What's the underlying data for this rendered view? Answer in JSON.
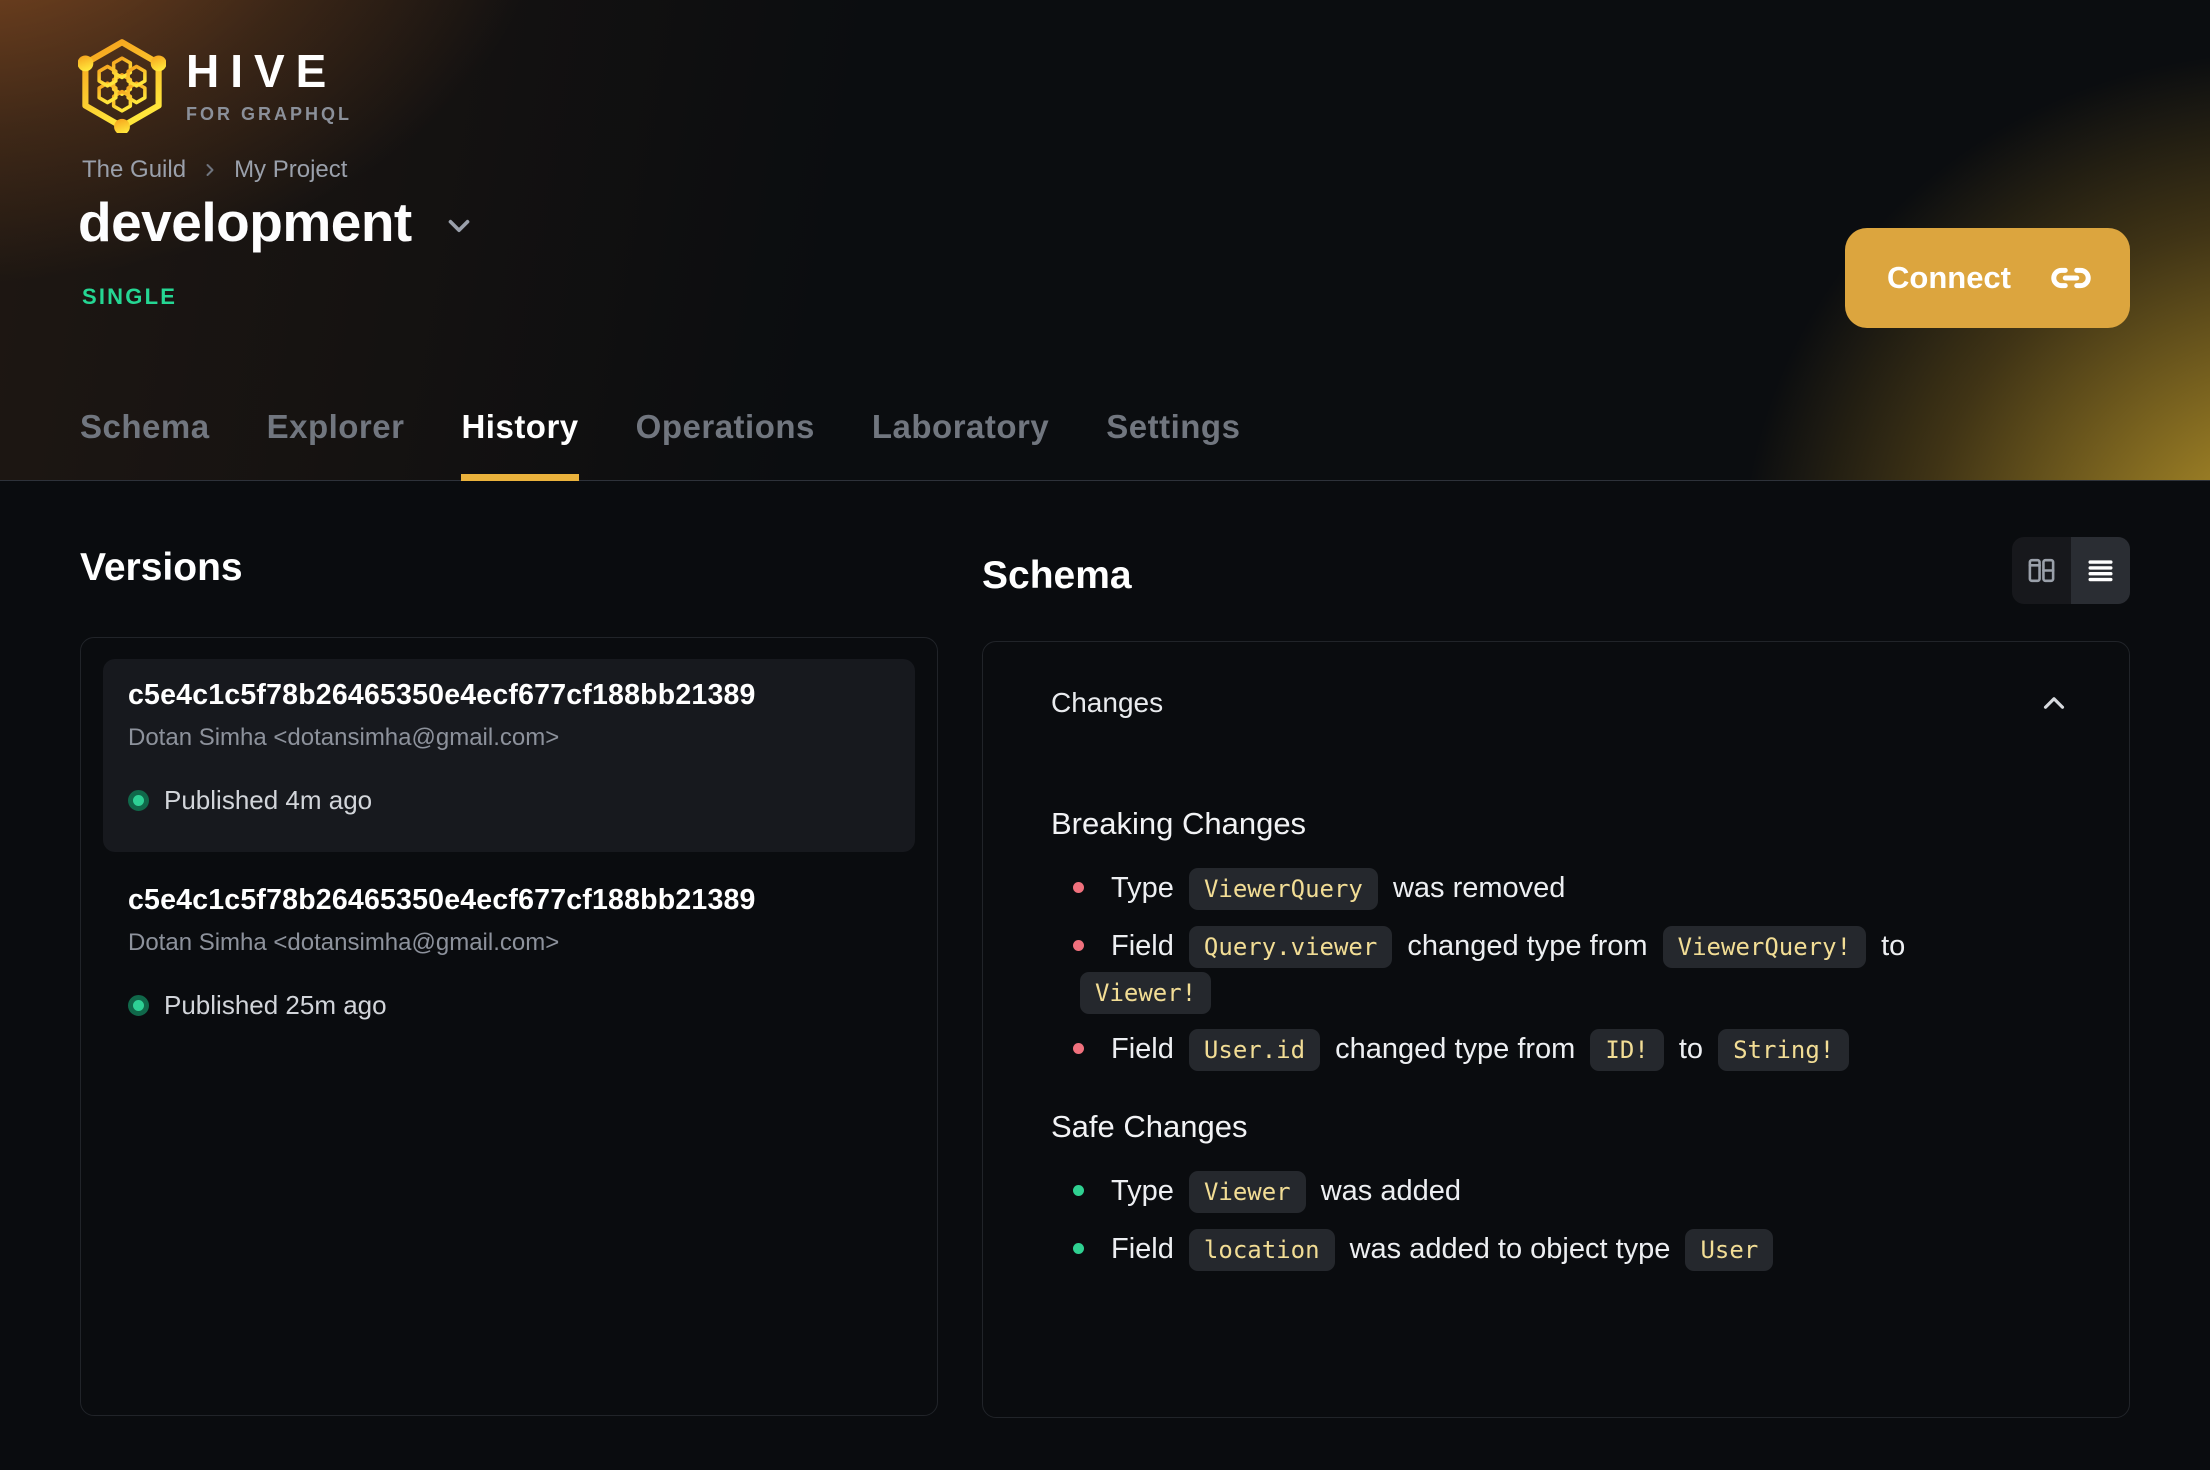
{
  "brand": {
    "name": "HIVE",
    "tagline": "FOR GRAPHQL"
  },
  "breadcrumb": {
    "items": [
      "The Guild",
      "My Project"
    ]
  },
  "target": {
    "name": "development",
    "badge": "SINGLE"
  },
  "connect": {
    "label": "Connect"
  },
  "nav": {
    "tabs": [
      {
        "label": "Schema",
        "active": false
      },
      {
        "label": "Explorer",
        "active": false
      },
      {
        "label": "History",
        "active": true
      },
      {
        "label": "Operations",
        "active": false
      },
      {
        "label": "Laboratory",
        "active": false
      },
      {
        "label": "Settings",
        "active": false
      }
    ]
  },
  "versions": {
    "heading": "Versions",
    "items": [
      {
        "hash": "c5e4c1c5f78b26465350e4ecf677cf188bb21389",
        "author": "Dotan Simha <dotansimha@gmail.com>",
        "status": "Published 4m ago",
        "highlighted": true
      },
      {
        "hash": "c5e4c1c5f78b26465350e4ecf677cf188bb21389",
        "author": "Dotan Simha <dotansimha@gmail.com>",
        "status": "Published 25m ago",
        "highlighted": false
      }
    ]
  },
  "schema": {
    "heading": "Schema",
    "view_toggle": {
      "options": [
        "columns-view",
        "list-view"
      ],
      "active": "list-view"
    },
    "changes": {
      "label": "Changes",
      "collapsed": false,
      "sections": [
        {
          "title": "Breaking Changes",
          "kind": "breaking",
          "items": [
            [
              {
                "text": "Type "
              },
              {
                "code": "ViewerQuery"
              },
              {
                "text": " was removed"
              }
            ],
            [
              {
                "text": "Field "
              },
              {
                "code": "Query.viewer"
              },
              {
                "text": " changed type from "
              },
              {
                "code": "ViewerQuery!"
              },
              {
                "text": " to "
              },
              {
                "code": "Viewer!"
              }
            ],
            [
              {
                "text": "Field "
              },
              {
                "code": "User.id"
              },
              {
                "text": " changed type from "
              },
              {
                "code": "ID!"
              },
              {
                "text": " to "
              },
              {
                "code": "String!"
              }
            ]
          ]
        },
        {
          "title": "Safe Changes",
          "kind": "safe",
          "items": [
            [
              {
                "text": "Type "
              },
              {
                "code": "Viewer"
              },
              {
                "text": " was added"
              }
            ],
            [
              {
                "text": "Field "
              },
              {
                "code": "location"
              },
              {
                "text": " was added to object type "
              },
              {
                "code": "User"
              }
            ]
          ]
        }
      ]
    }
  },
  "colors": {
    "accent_yellow": "#dca53e",
    "tab_underline": "#eab23c",
    "badge_green": "#25d693",
    "published_dot": "#2ed095",
    "breaking_bullet": "#f0717d",
    "safe_bullet": "#2fd191",
    "code_text": "#f2dd95",
    "page_background": "#0a0c0f"
  }
}
